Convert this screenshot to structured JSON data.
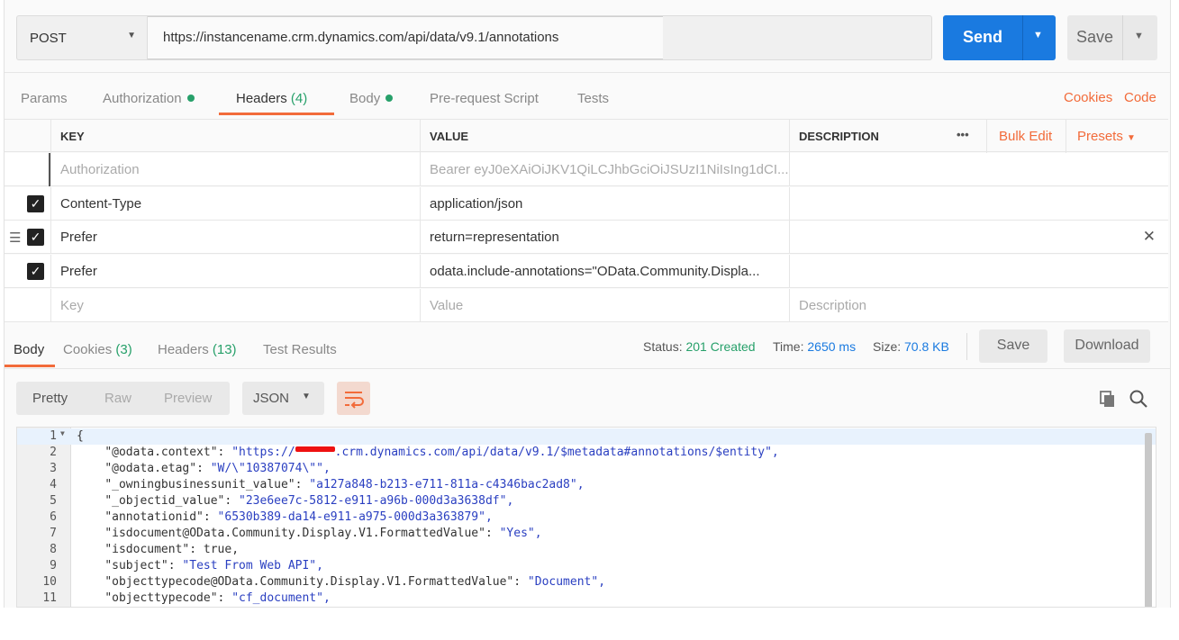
{
  "request": {
    "method": "POST",
    "url": "https://instancename.crm.dynamics.com/api/data/v9.1/annotations",
    "send_label": "Send",
    "save_label": "Save"
  },
  "req_tabs": {
    "params": "Params",
    "authorization": "Authorization",
    "headers": "Headers",
    "headers_count": "(4)",
    "body": "Body",
    "prerequest": "Pre-request Script",
    "tests": "Tests",
    "cookies": "Cookies",
    "code": "Code"
  },
  "headers_table": {
    "col_key": "KEY",
    "col_value": "VALUE",
    "col_description": "DESCRIPTION",
    "more": "•••",
    "bulk_edit": "Bulk Edit",
    "presets": "Presets",
    "rows": [
      {
        "key": "Authorization",
        "value": "Bearer eyJ0eXAiOiJKV1QiLCJhbGciOiJSUzI1NiIsIng1dCI..."
      },
      {
        "key": "Content-Type",
        "value": "application/json"
      },
      {
        "key": "Prefer",
        "value": "return=representation"
      },
      {
        "key": "Prefer",
        "value": "odata.include-annotations=\"OData.Community.Displa..."
      }
    ],
    "placeholder_key": "Key",
    "placeholder_value": "Value",
    "placeholder_description": "Description"
  },
  "response": {
    "tab_body": "Body",
    "tab_cookies": "Cookies",
    "cookies_count": "(3)",
    "tab_headers": "Headers",
    "headers_count": "(13)",
    "tab_test_results": "Test Results",
    "status_label": "Status:",
    "status_value": "201 Created",
    "time_label": "Time:",
    "time_value": "2650 ms",
    "size_label": "Size:",
    "size_value": "70.8 KB",
    "save_label": "Save",
    "download_label": "Download",
    "view_pretty": "Pretty",
    "view_raw": "Raw",
    "view_preview": "Preview",
    "format": "JSON"
  },
  "code_lines": [
    {
      "n": "1",
      "text": "{"
    },
    {
      "n": "2",
      "k": "\"@odata.context\"",
      "pre": "\"https://",
      "post": ".crm.dynamics.com/api/data/v9.1/$metadata#annotations/$entity\","
    },
    {
      "n": "3",
      "k": "\"@odata.etag\"",
      "v": "\"W/\\\"10387074\\\"\","
    },
    {
      "n": "4",
      "k": "\"_owningbusinessunit_value\"",
      "v": "\"a127a848-b213-e711-811a-c4346bac2ad8\","
    },
    {
      "n": "5",
      "k": "\"_objectid_value\"",
      "v": "\"23e6ee7c-5812-e911-a96b-000d3a3638df\","
    },
    {
      "n": "6",
      "k": "\"annotationid\"",
      "v": "\"6530b389-da14-e911-a975-000d3a363879\","
    },
    {
      "n": "7",
      "k": "\"isdocument@OData.Community.Display.V1.FormattedValue\"",
      "v": "\"Yes\","
    },
    {
      "n": "8",
      "k": "\"isdocument\"",
      "v": "true,"
    },
    {
      "n": "9",
      "k": "\"subject\"",
      "v": "\"Test From Web API\","
    },
    {
      "n": "10",
      "k": "\"objecttypecode@OData.Community.Display.V1.FormattedValue\"",
      "v": "\"Document\","
    },
    {
      "n": "11",
      "k": "\"objecttypecode\"",
      "v": "\"cf_document\","
    }
  ]
}
